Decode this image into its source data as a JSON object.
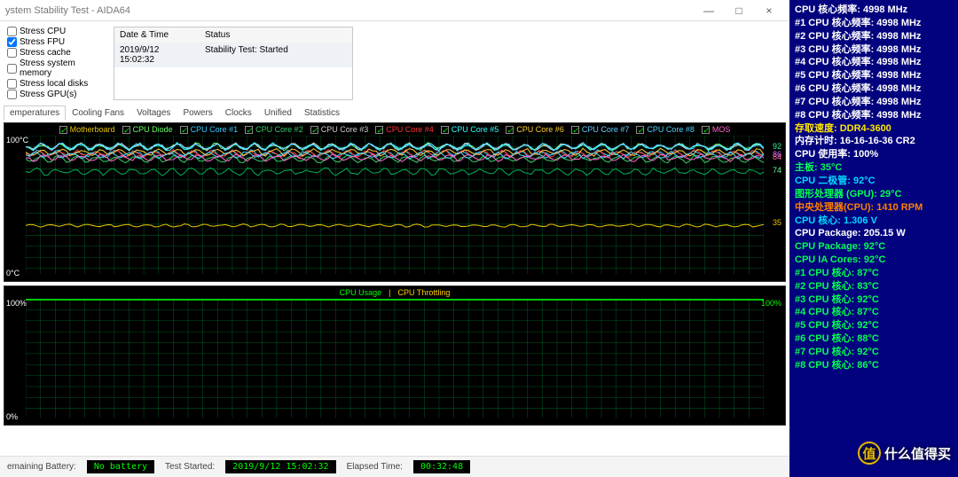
{
  "window": {
    "title": "ystem Stability Test - AIDA64",
    "min": "—",
    "max": "□",
    "close": "×"
  },
  "stress": {
    "items": [
      {
        "label": "Stress CPU",
        "checked": false
      },
      {
        "label": "Stress FPU",
        "checked": true
      },
      {
        "label": "Stress cache",
        "checked": false
      },
      {
        "label": "Stress system memory",
        "checked": false
      },
      {
        "label": "Stress local disks",
        "checked": false
      },
      {
        "label": "Stress GPU(s)",
        "checked": false
      }
    ]
  },
  "log": {
    "h1": "Date & Time",
    "h2": "Status",
    "r1c1": "2019/9/12 15:02:32",
    "r1c2": "Stability Test: Started"
  },
  "tabs": [
    "emperatures",
    "Cooling Fans",
    "Voltages",
    "Powers",
    "Clocks",
    "Unified",
    "Statistics"
  ],
  "temp_chart": {
    "y_top": "100°C",
    "y_bot": "0°C",
    "right_labels": [
      {
        "v": "92",
        "c": "#33ccff"
      },
      {
        "v": "92",
        "c": "#33cc66"
      },
      {
        "v": "86",
        "c": "#cc66ff"
      },
      {
        "v": "84",
        "c": "#ff66aa"
      },
      {
        "v": "74",
        "c": "#66ff99"
      },
      {
        "v": "35",
        "c": "#e6c200"
      }
    ],
    "legend": [
      {
        "name": "Motherboard",
        "c": "#e6c200"
      },
      {
        "name": "CPU Diode",
        "c": "#66ff66"
      },
      {
        "name": "CPU Core #1",
        "c": "#33ccff"
      },
      {
        "name": "CPU Core #2",
        "c": "#33cc66"
      },
      {
        "name": "CPU Core #3",
        "c": "#cccccc"
      },
      {
        "name": "CPU Core #4",
        "c": "#ff3333"
      },
      {
        "name": "CPU Core #5",
        "c": "#33ffff"
      },
      {
        "name": "CPU Core #6",
        "c": "#ffcc33"
      },
      {
        "name": "CPU Core #7",
        "c": "#66ccff"
      },
      {
        "name": "CPU Core #8",
        "c": "#4dd2ff"
      },
      {
        "name": "MOS",
        "c": "#ff66cc"
      }
    ]
  },
  "usage_chart": {
    "y_top": "100%",
    "y_bot": "0%",
    "right": "100%",
    "legend_l": "CPU Usage",
    "legend_r": "CPU Throttling"
  },
  "status": {
    "battery_lbl": "emaining Battery:",
    "battery_val": "No battery",
    "started_lbl": "Test Started:",
    "started_val": "2019/9/12  15:02:32",
    "elapsed_lbl": "Elapsed Time:",
    "elapsed_val": "00:32:48"
  },
  "side": [
    {
      "t": "CPU 核心频率: 4998 MHz",
      "c": "#ffffff"
    },
    {
      "t": "#1 CPU 核心频率: 4998 MHz",
      "c": "#ffffff"
    },
    {
      "t": "#2 CPU 核心频率: 4998 MHz",
      "c": "#ffffff"
    },
    {
      "t": "#3 CPU 核心频率: 4998 MHz",
      "c": "#ffffff"
    },
    {
      "t": "#4 CPU 核心频率: 4998 MHz",
      "c": "#ffffff"
    },
    {
      "t": "#5 CPU 核心频率: 4998 MHz",
      "c": "#ffffff"
    },
    {
      "t": "#6 CPU 核心频率: 4998 MHz",
      "c": "#ffffff"
    },
    {
      "t": "#7 CPU 核心频率: 4998 MHz",
      "c": "#ffffff"
    },
    {
      "t": "#8 CPU 核心频率: 4998 MHz",
      "c": "#ffffff"
    },
    {
      "t": "存取速度: DDR4-3600",
      "c": "#ffe600"
    },
    {
      "t": "内存计时: 16-16-16-36 CR2",
      "c": "#ffffff"
    },
    {
      "t": "CPU 使用率: 100%",
      "c": "#ffffff"
    },
    {
      "t": "主板: 35°C",
      "c": "#00ff55"
    },
    {
      "t": "CPU 二极管: 92°C",
      "c": "#00d9ff"
    },
    {
      "t": "图形处理器 (GPU): 29°C",
      "c": "#00ff55"
    },
    {
      "t": "中央处理器(CPU): 1410 RPM",
      "c": "#ff8000"
    },
    {
      "t": "CPU 核心: 1.306 V",
      "c": "#00d9ff"
    },
    {
      "t": "CPU Package: 205.15 W",
      "c": "#ffffff"
    },
    {
      "t": "CPU Package: 92°C",
      "c": "#00ff55"
    },
    {
      "t": "CPU IA Cores: 92°C",
      "c": "#00ff55"
    },
    {
      "t": "#1 CPU 核心: 87°C",
      "c": "#00ff55"
    },
    {
      "t": "#2 CPU 核心: 83°C",
      "c": "#00ff55"
    },
    {
      "t": "#3 CPU 核心: 92°C",
      "c": "#00ff55"
    },
    {
      "t": "#4 CPU 核心: 87°C",
      "c": "#00ff55"
    },
    {
      "t": "#5 CPU 核心: 92°C",
      "c": "#00ff55"
    },
    {
      "t": "#6 CPU 核心: 88°C",
      "c": "#00ff55"
    },
    {
      "t": "#7 CPU 核心: 92°C",
      "c": "#00ff55"
    },
    {
      "t": "#8 CPU 核心: 86°C",
      "c": "#00ff55"
    }
  ],
  "watermark": {
    "logo": "值",
    "text": "什么值得买"
  },
  "chart_data": [
    {
      "type": "line",
      "title": "Temperatures",
      "ylabel": "°C",
      "ylim": [
        0,
        100
      ],
      "x": [
        0,
        100
      ],
      "series": [
        {
          "name": "Motherboard",
          "color": "#e6c200",
          "approx": 35
        },
        {
          "name": "CPU Diode",
          "color": "#66ff66",
          "approx": 92
        },
        {
          "name": "CPU Core #1",
          "color": "#33ccff",
          "approx": 87
        },
        {
          "name": "CPU Core #2",
          "color": "#33cc66",
          "approx": 83
        },
        {
          "name": "CPU Core #3",
          "color": "#cccccc",
          "approx": 92
        },
        {
          "name": "CPU Core #4",
          "color": "#ff3333",
          "approx": 87
        },
        {
          "name": "CPU Core #5",
          "color": "#33ffff",
          "approx": 92
        },
        {
          "name": "CPU Core #6",
          "color": "#ffcc33",
          "approx": 88
        },
        {
          "name": "CPU Core #7",
          "color": "#66ccff",
          "approx": 92
        },
        {
          "name": "CPU Core #8",
          "color": "#4dd2ff",
          "approx": 86
        },
        {
          "name": "MOS",
          "color": "#ff66cc",
          "approx": 84
        },
        {
          "name": "(green trace)",
          "color": "#00aa55",
          "approx": 74
        }
      ]
    },
    {
      "type": "line",
      "title": "CPU Usage | CPU Throttling",
      "ylabel": "%",
      "ylim": [
        0,
        100
      ],
      "series": [
        {
          "name": "CPU Usage",
          "color": "#00ff00",
          "approx": 100
        },
        {
          "name": "CPU Throttling",
          "color": "#ffcc00",
          "approx": 0
        }
      ]
    }
  ]
}
